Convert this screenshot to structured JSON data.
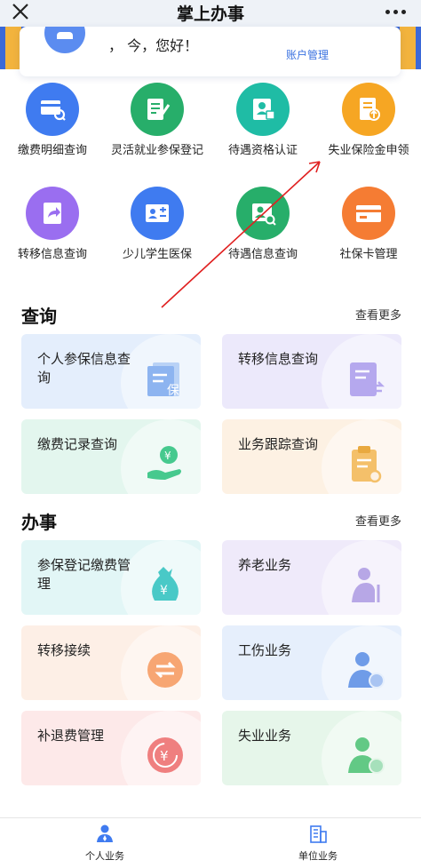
{
  "topbar": {
    "title": "掌上办事"
  },
  "user": {
    "greeting": "，  今，您好！",
    "account_link": "账户管理"
  },
  "quick_items": [
    {
      "label": "缴费明细查询",
      "icon": "payment-detail-search-icon",
      "color": "#3f7bf0"
    },
    {
      "label": "灵活就业参保登记",
      "icon": "flexible-employment-register-icon",
      "color": "#27ae6a"
    },
    {
      "label": "待遇资格认证",
      "icon": "benefit-qualification-icon",
      "color": "#1fbca5"
    },
    {
      "label": "失业保险金申领",
      "icon": "unemployment-claim-icon",
      "color": "#f6a623"
    },
    {
      "label": "转移信息查询",
      "icon": "transfer-info-icon",
      "color": "#9a6ef0"
    },
    {
      "label": "少儿学生医保",
      "icon": "child-medical-insurance-icon",
      "color": "#3f7bf0"
    },
    {
      "label": "待遇信息查询",
      "icon": "benefit-info-search-icon",
      "color": "#27ae6a"
    },
    {
      "label": "社保卡管理",
      "icon": "social-security-card-icon",
      "color": "#f57c33"
    }
  ],
  "query_section": {
    "title": "查询",
    "more": "查看更多",
    "cards": [
      {
        "label": "个人参保信息查询",
        "icon": "insurance-doc-icon",
        "bg": "#e4eefc",
        "accent": "#8db4f0"
      },
      {
        "label": "转移信息查询",
        "icon": "transfer-doc-icon",
        "bg": "#ece9fb",
        "accent": "#b5a8ee"
      },
      {
        "label": "缴费记录查询",
        "icon": "payment-hand-icon",
        "bg": "#e3f6ee",
        "accent": "#46c98e"
      },
      {
        "label": "业务跟踪查询",
        "icon": "tracking-clipboard-icon",
        "bg": "#fdf1e3",
        "accent": "#f4c06a"
      }
    ]
  },
  "work_section": {
    "title": "办事",
    "more": "查看更多",
    "cards": [
      {
        "label": "参保登记缴费管理",
        "icon": "money-bag-icon",
        "bg": "#e2f6f6",
        "accent": "#49c9c7"
      },
      {
        "label": "养老业务",
        "icon": "elderly-icon",
        "bg": "#efeafa",
        "accent": "#b7a7e6"
      },
      {
        "label": "转移接续",
        "icon": "transfer-arrows-icon",
        "bg": "#fdefe6",
        "accent": "#f7a673"
      },
      {
        "label": "工伤业务",
        "icon": "work-injury-icon",
        "bg": "#e6effc",
        "accent": "#6f9ce8"
      },
      {
        "label": "补退费管理",
        "icon": "refund-icon",
        "bg": "#fde9e9",
        "accent": "#ef7f7f"
      },
      {
        "label": "失业业务",
        "icon": "unemployment-person-icon",
        "bg": "#e6f6ea",
        "accent": "#62c985"
      }
    ]
  },
  "bottom_nav": [
    {
      "label": "个人业务",
      "icon": "person-icon",
      "color": "#3f7bf0"
    },
    {
      "label": "单位业务",
      "icon": "building-icon",
      "color": "#3f7bf0"
    }
  ],
  "annotation": {
    "color": "#e02020"
  }
}
